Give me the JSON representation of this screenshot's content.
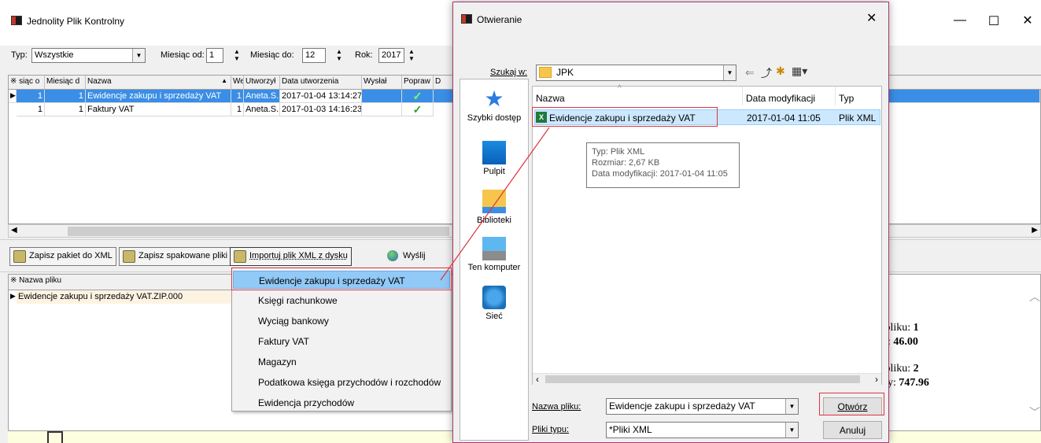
{
  "main": {
    "title": "Jednolity Plik Kontrolny",
    "filters": {
      "typ_label": "Typ:",
      "typ_value": "Wszystkie",
      "od_label": "Miesiąc od:",
      "od_value": "1",
      "do_label": "Miesiąc do:",
      "do_value": "12",
      "rok_label": "Rok:",
      "rok_value": "2017"
    },
    "grid_columns": [
      "siąc o",
      "Miesiąc d",
      "Nazwa",
      "Wer",
      "Utworzył",
      "Data utworzenia",
      "Wysłał",
      "Popraw",
      "D"
    ],
    "rows": [
      {
        "mod": "1",
        "mdo": "1",
        "nazwa": "Ewidencje zakupu i sprzedaży VAT",
        "wer": "1",
        "utw": "Aneta.S.",
        "data": "2017-01-04 13:14:27"
      },
      {
        "mod": "1",
        "mdo": "1",
        "nazwa": "Faktury VAT",
        "wer": "1",
        "utw": "Aneta.S.",
        "data": "2017-01-03 14:16:23"
      }
    ],
    "buttons": {
      "zapisz_xml": "Zapisz pakiet do XML",
      "zapisz_spak": "Zapisz spakowane pliki",
      "importuj": "Importuj plik XML z dysku",
      "wyslij": "Wyślij"
    },
    "files_header": "Nazwa pliku",
    "files": [
      "Ewidencje zakupu i sprzedaży VAT.ZIP.000"
    ],
    "info": {
      "line1a": "v pliku: ",
      "val1a": "1",
      "line1b": "ny: ",
      "val1b": "46.00",
      "line2a": "v pliku: ",
      "val2a": "2",
      "line2b": "ony: ",
      "val2b": "747.96"
    }
  },
  "menu": {
    "items": [
      "Ewidencje zakupu i sprzedaży VAT",
      "Księgi rachunkowe",
      "Wyciąg bankowy",
      "Faktury VAT",
      "Magazyn",
      "Podatkowa księga przychodów i rozchodów",
      "Ewidencja przychodów"
    ]
  },
  "dialog": {
    "title": "Otwieranie",
    "lookin_label": "Szukaj w:",
    "lookin_value": "JPK",
    "places": [
      "Szybki dostęp",
      "Pulpit",
      "Biblioteki",
      "Ten komputer",
      "Sieć"
    ],
    "columns": [
      "Nazwa",
      "Data modyfikacji",
      "Typ"
    ],
    "file": {
      "name": "Ewidencje zakupu i sprzedaży VAT",
      "date": "2017-01-04 11:05",
      "type": "Plik XML"
    },
    "tooltip": {
      "line1": "Typ: Plik XML",
      "line2": "Rozmiar: 2,67 KB",
      "line3": "Data modyfikacji: 2017-01-04 11:05"
    },
    "filename_label": "Nazwa pliku:",
    "filename_value": "Ewidencje zakupu i sprzedaży VAT",
    "filetype_label": "Pliki typu:",
    "filetype_value": "*Pliki XML",
    "open_button": "Otwórz",
    "cancel_button": "Anuluj"
  },
  "colors": {
    "selection": "#3a8ee6",
    "highlight": "#e0343d",
    "menu_hover": "#91c9f7"
  }
}
